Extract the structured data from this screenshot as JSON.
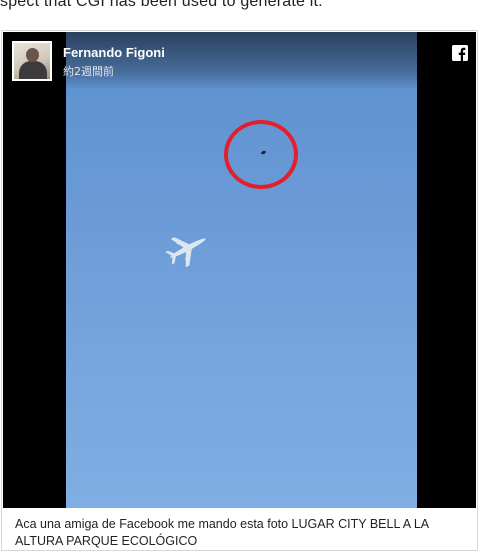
{
  "article": {
    "visible_text": "spect that CGI has been used to generate it."
  },
  "post": {
    "author_name": "Fernando Figoni",
    "timestamp": "約2週間前",
    "caption": "Aca una amiga de Facebook me mando esta foto LUGAR CITY BELL A LA ALTURA PARQUE ECOLÓGICO"
  },
  "icons": {
    "platform_logo": "facebook-icon",
    "highlight_marker": "red-circle-annotation",
    "aircraft": "airplane-silhouette"
  },
  "colors": {
    "sky": "#6a9ad6",
    "annotation_red": "#e2202b",
    "letterbox": "#000000"
  }
}
